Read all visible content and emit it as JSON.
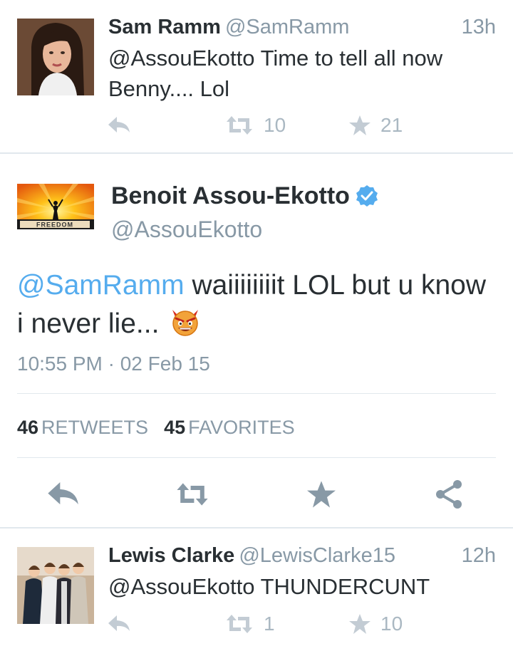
{
  "tweet_above": {
    "name": "Sam Ramm",
    "handle": "@SamRamm",
    "time": "13h",
    "text_line1": "@AssouEkotto Time to tell all now",
    "text_line2": "Benny.... Lol",
    "retweets": "10",
    "favorites": "21"
  },
  "main_tweet": {
    "name": "Benoit Assou-Ekotto",
    "handle": "@AssouEkotto",
    "avatar_label": "FREEDOM",
    "mention": "@SamRamm",
    "text_line1_rest": " waiiiiiiiit LOL but u know",
    "text_line2": "i never lie... ",
    "timestamp": "10:55 PM · 02 Feb 15",
    "retweet_count": "46",
    "retweet_label": "RETWEETS",
    "favorite_count": "45",
    "favorite_label": "FAVORITES"
  },
  "tweet_below": {
    "name": "Lewis Clarke",
    "handle": "@LewisClarke15",
    "time": "12h",
    "text": "@AssouEkotto THUNDERCUNT",
    "retweets": "1",
    "favorites": "10"
  },
  "icons": {
    "reply": "reply-icon",
    "retweet": "retweet-icon",
    "favorite": "star-icon",
    "share": "share-icon",
    "verified": "verified-badge-icon",
    "emoji": "devil-emoji-icon"
  },
  "colors": {
    "link": "#55acee",
    "muted": "#8899a6",
    "text": "#292f33",
    "verified": "#55acee"
  }
}
